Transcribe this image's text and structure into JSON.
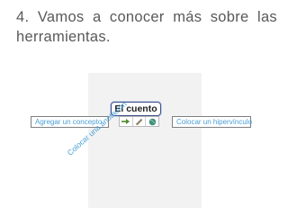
{
  "slide": {
    "title": "4. Vamos a conocer más sobre las herramientas."
  },
  "figure": {
    "concept_node": "El cuento",
    "toolbar_icons": [
      "arrow-icon",
      "pencil-icon",
      "globe-icon"
    ],
    "callouts": {
      "add_concept": "Agregar un concepto",
      "add_hyperlink": "Colocar un hipervínculo",
      "add_annotation": "Colocar una anotación"
    }
  }
}
